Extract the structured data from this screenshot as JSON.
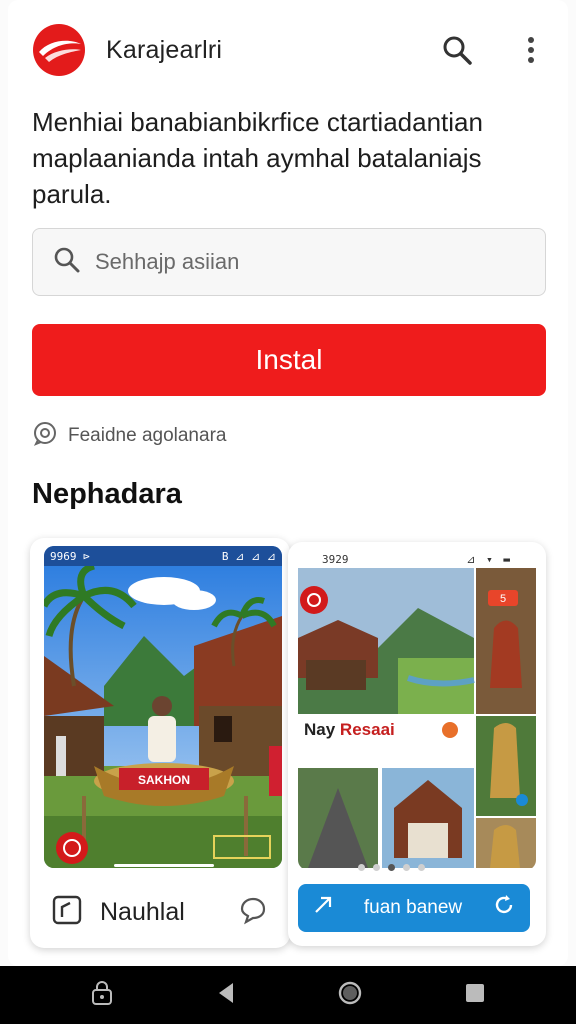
{
  "header": {
    "app_name": "Karajearlri",
    "logo_icon": "swoosh-logo-icon",
    "search_icon": "search-icon",
    "more_icon": "more-vert-icon"
  },
  "description": "Menhiai banabianbikrfice ctartiadantian maplaanianda intah aymhal batalaniajs parula.",
  "search": {
    "placeholder": "Sehhajp asiian"
  },
  "install_button": {
    "label": "Instal"
  },
  "feature": {
    "label": "Feaidne agolanara",
    "icon": "badge-icon"
  },
  "section": {
    "title": "Nephadara"
  },
  "screenshot1": {
    "status_left": "9969 ⊳",
    "status_right": "B ⊿ ⊿ ⊿",
    "boat_label": "SAKHON",
    "footer_label": "Nauhlal",
    "footer_icon": "square-app-icon",
    "chat_icon": "chat-bubble-icon"
  },
  "screenshot2": {
    "status_time": "3929",
    "status_right": "⊿ ▾ ▬",
    "overlay_title_a": "Nay ",
    "overlay_title_b": "Resaai",
    "badge_label": "5",
    "button_label": "fuan banew",
    "carousel_count": 5,
    "carousel_active": 2
  },
  "colors": {
    "accent": "#ef1c1c",
    "blue": "#1a8ad6",
    "navbar": "#000000"
  }
}
